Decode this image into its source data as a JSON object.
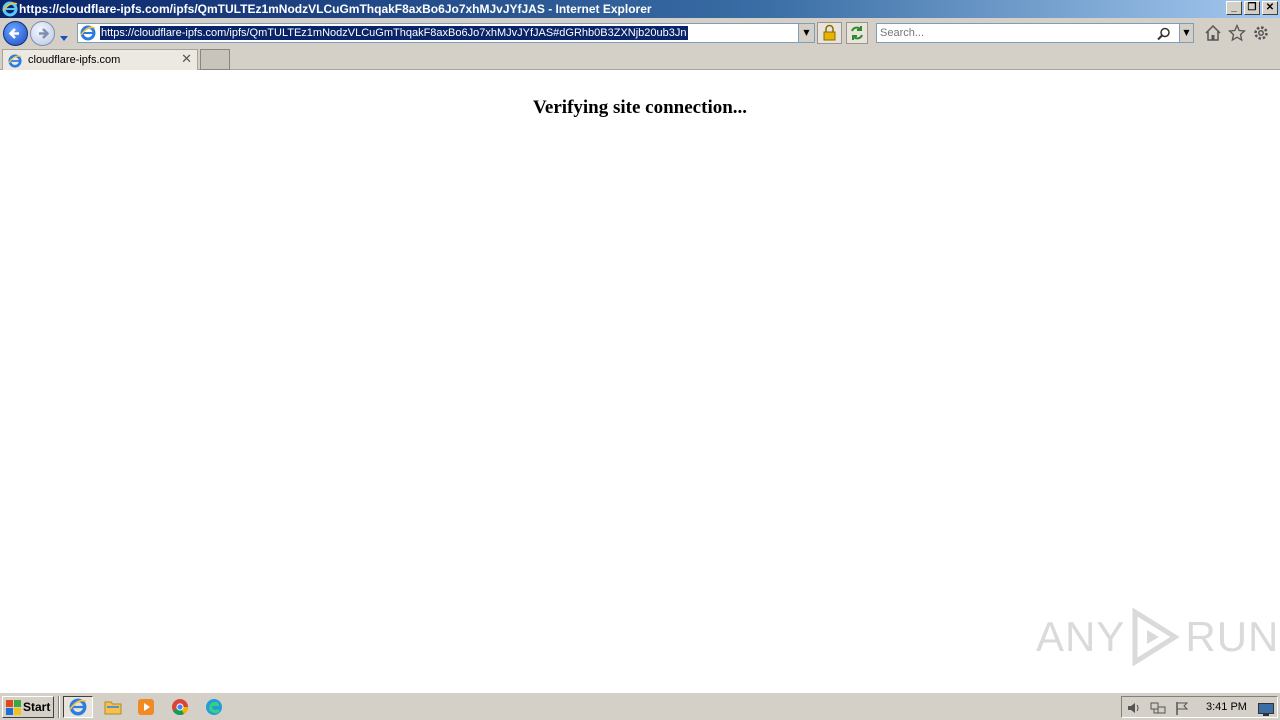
{
  "window": {
    "title": "https://cloudflare-ipfs.com/ipfs/QmTULTEz1mNodzVLCuGmThqakF8axBo6Jo7xhMJvJYfJAS - Internet Explorer",
    "controls": {
      "minimize": "_",
      "restore": "❐",
      "close": "✕"
    }
  },
  "address_bar": {
    "url": "https://cloudflare-ipfs.com/ipfs/QmTULTEz1mNodzVLCuGmThqakF8axBo6Jo7xhMJvJYfJAS#dGRhb0B3ZXNjb20ub3Jn"
  },
  "search": {
    "placeholder": "Search..."
  },
  "tabs": [
    {
      "label": "cloudflare-ipfs.com",
      "close": "✕"
    }
  ],
  "page": {
    "heading": "Verifying site connection..."
  },
  "watermark": {
    "text_left": "ANY",
    "text_right": "RUN"
  },
  "taskbar": {
    "start_label": "Start",
    "apps": [
      "internet-explorer",
      "file-explorer",
      "media-player",
      "chrome",
      "edge"
    ],
    "clock": "3:41 PM"
  },
  "colors": {
    "titlebar": "#0a246a",
    "chrome": "#d4d0c8",
    "selection": "#0a246a"
  }
}
